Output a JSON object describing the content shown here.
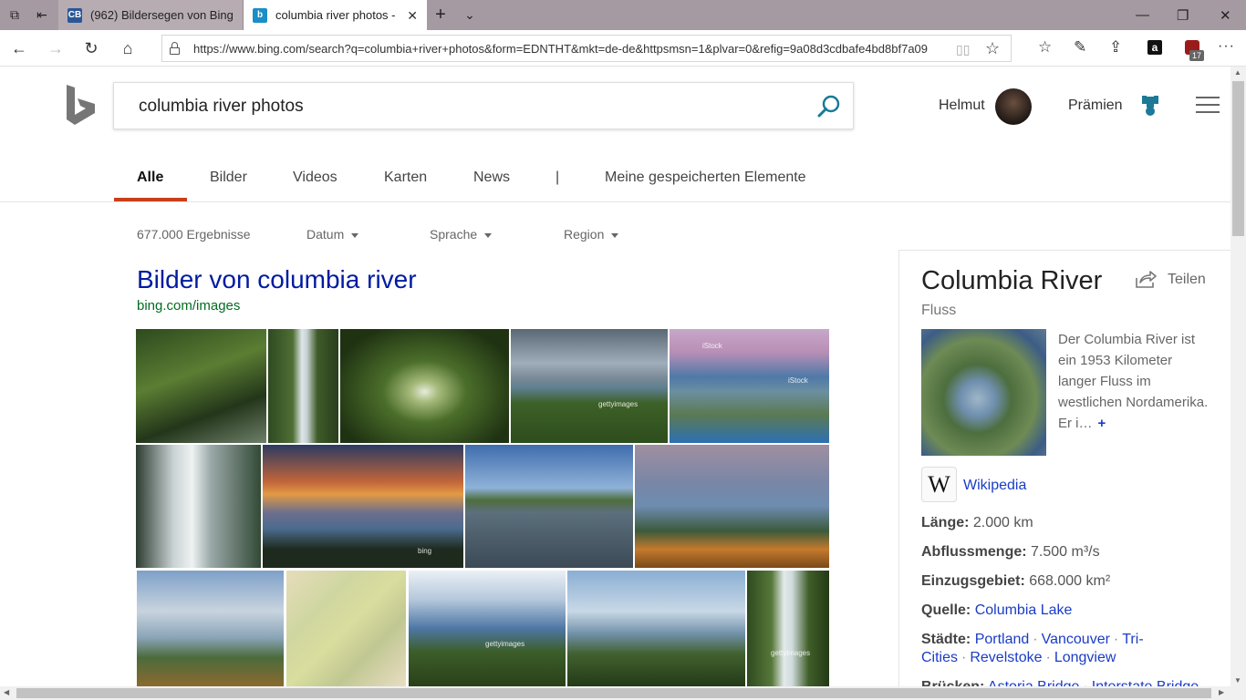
{
  "browser": {
    "tabs": [
      {
        "title": "(962) Bildersegen von Bing",
        "favicon": "CB"
      },
      {
        "title": "columbia river photos -",
        "favicon": "b"
      }
    ],
    "url": "https://www.bing.com/search?q=columbia+river+photos&form=EDNTHT&mkt=de-de&httpsmsn=1&plvar=0&refig=9a08d3cdbafe4bd8bf7a09",
    "extension_badge": "17",
    "amazon_label": "a"
  },
  "search": {
    "query": "columbia river photos"
  },
  "header": {
    "user_name": "Helmut",
    "rewards_label": "Prämien"
  },
  "scopes": {
    "all": "Alle",
    "images": "Bilder",
    "videos": "Videos",
    "maps": "Karten",
    "news": "News",
    "divider": "|",
    "saved": "Meine gespeicherten Elemente"
  },
  "filters": {
    "count": "677.000 Ergebnisse",
    "date": "Datum",
    "language": "Sprache",
    "region": "Region"
  },
  "images_block": {
    "title": "Bilder von columbia river",
    "source": "bing.com/images",
    "watermarks": [
      "gettyimages",
      "iStock",
      "iStock",
      "bing",
      "gettyimages",
      "gettyimages"
    ]
  },
  "knowledge": {
    "title": "Columbia River",
    "share": "Teilen",
    "subtitle": "Fluss",
    "description": "Der Columbia River ist ein 1953 Kilometer langer Fluss im westlichen Nordamerika. Er i…",
    "more": "+",
    "wiki_label": "Wikipedia",
    "facts": {
      "length_label": "Länge:",
      "length_value": "2.000 km",
      "discharge_label": "Abflussmenge:",
      "discharge_value": "7.500 m³/s",
      "basin_label": "Einzugsgebiet:",
      "basin_value": "668.000 km²",
      "source_label": "Quelle:",
      "source_value": "Columbia Lake",
      "cities_label": "Städte:",
      "cities": [
        "Portland",
        "Vancouver",
        "Tri-Cities",
        "Revelstoke",
        "Longview"
      ],
      "bridges_label": "Brücken:",
      "bridges": [
        "Astoria Bridge",
        "Interstate Bridge"
      ]
    }
  }
}
